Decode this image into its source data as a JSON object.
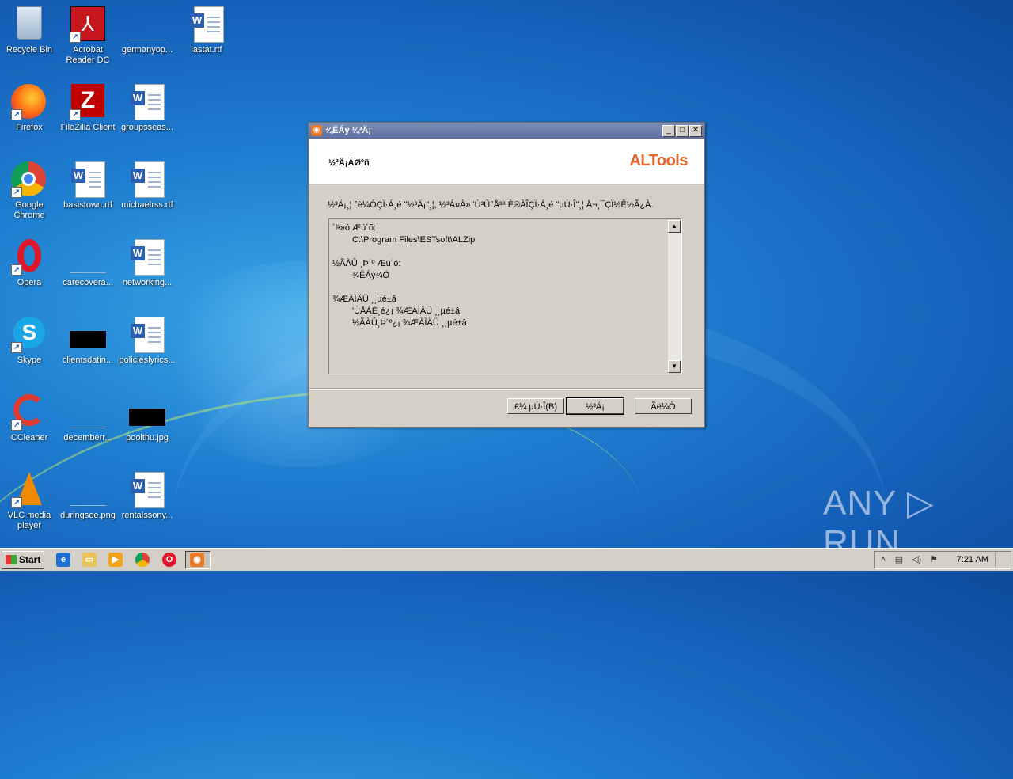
{
  "desktop": {
    "icons": [
      {
        "label": "Recycle Bin"
      },
      {
        "label": "Acrobat Reader DC"
      },
      {
        "label": "germanyop..."
      },
      {
        "label": "lastat.rtf"
      },
      {
        "label": "Firefox"
      },
      {
        "label": "FileZilla Client"
      },
      {
        "label": "groupsseas..."
      },
      {
        "label": "Google Chrome"
      },
      {
        "label": "basistown.rtf"
      },
      {
        "label": "michaelrss.rtf"
      },
      {
        "label": "Opera"
      },
      {
        "label": "carecovera..."
      },
      {
        "label": "networking..."
      },
      {
        "label": "Skype"
      },
      {
        "label": "clientsdatin..."
      },
      {
        "label": "policieslyrics..."
      },
      {
        "label": "CCleaner"
      },
      {
        "label": "decemberr..."
      },
      {
        "label": "poolthu.jpg"
      },
      {
        "label": "VLC media player"
      },
      {
        "label": "duringsee.png"
      },
      {
        "label": "rentalssony..."
      }
    ]
  },
  "dialog": {
    "title": "¾ËÁý ¼³Ä¡",
    "header_title": "½³Ä¡ÁØºñ",
    "brand": "ALTools",
    "instruction": "½³Ä¡¸¦ °è¼ÓÇÏ·Á¸é \"½³Ä¡\"¸¦, ½³Á¤À» 'Ù³Ù°Å³ª È®ÀÎÇÏ·Á¸é \"µÚ·Î\"¸¦ Å¬¸¯ÇÏ½Ê½Ã¿À.",
    "info_lines": [
      {
        "text": "´ë»ó Æú´õ:",
        "indent": false
      },
      {
        "text": "C:\\Program Files\\ESTsoft\\ALZip",
        "indent": true
      },
      {
        "text": "",
        "indent": false
      },
      {
        "text": "½ÃÀÛ ¸Þ´º Æú´õ:",
        "indent": false
      },
      {
        "text": "¾ËÁý¾Ö",
        "indent": true
      },
      {
        "text": "",
        "indent": false
      },
      {
        "text": "¾ÆÀÌÄÜ ¸¸µé±â",
        "indent": false
      },
      {
        "text": "'ÙÅÁÈ­¸é¿¡ ¾ÆÀÌÄÜ ¸¸µé±â",
        "indent": true
      },
      {
        "text": "½ÃÀÛ¸Þ´º¿¡ ¾ÆÀÌÄÜ ¸¸µé±â",
        "indent": true
      }
    ],
    "buttons": {
      "back": "£¼ µÚ·Î(B)",
      "install": "½³Ä¡",
      "cancel": "Ãë¼Ò"
    }
  },
  "taskbar": {
    "start_label": "Start",
    "clock": "7:21 AM"
  },
  "watermark": "ANY ▷ RUN"
}
